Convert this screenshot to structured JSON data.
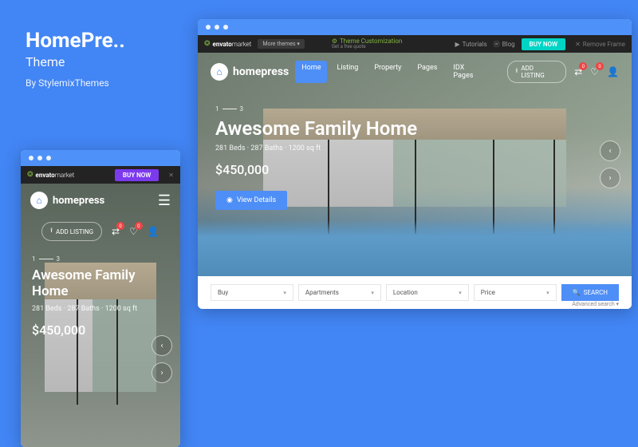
{
  "title": {
    "name": "HomePre..",
    "sub": "Theme",
    "by": "By StylemixThemes"
  },
  "envato": {
    "brand1": "envato",
    "brand2": "market",
    "more": "More themes",
    "cust": "Theme Customization",
    "cust_sub": "Get a free quote",
    "tutorials": "Tutorials",
    "blog": "Blog",
    "buy": "BUY NOW",
    "remove": "Remove Frame"
  },
  "logo": "homepress",
  "nav": {
    "home": "Home",
    "listing": "Listing",
    "property": "Property",
    "pages": "Pages",
    "idx": "IDX Pages"
  },
  "add_listing": "ADD LISTING",
  "badges": {
    "compare": "0",
    "fav": "0"
  },
  "pager": {
    "cur": "1",
    "total": "3"
  },
  "hero": {
    "title": "Awesome Family Home",
    "meta": "281 Beds · 287 Baths · 1200 sq ft",
    "price": "$450,000",
    "view": "View Details"
  },
  "search": {
    "f1": "Buy",
    "f2": "Apartments",
    "f3": "Location",
    "f4": "Price",
    "btn": "SEARCH",
    "adv": "Advanced search"
  }
}
